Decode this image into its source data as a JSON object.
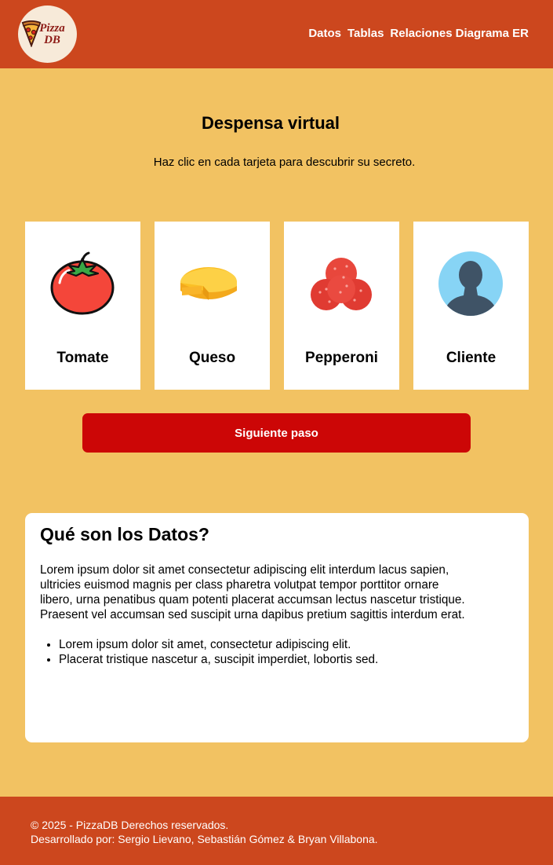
{
  "header": {
    "logo_text_line1": "Pizza",
    "logo_text_line2": "DB",
    "nav": [
      "Datos",
      "Tablas",
      "Relaciones",
      "Diagrama ER"
    ]
  },
  "main": {
    "title": "Despensa virtual",
    "subtitle": "Haz clic en cada tarjeta para descubrir su secreto.",
    "cards": [
      {
        "label": "Tomate",
        "icon": "tomato-icon"
      },
      {
        "label": "Queso",
        "icon": "cheese-icon"
      },
      {
        "label": "Pepperoni",
        "icon": "pepperoni-icon"
      },
      {
        "label": "Cliente",
        "icon": "user-avatar-icon"
      }
    ],
    "next_button": "Siguiente paso"
  },
  "info": {
    "title": "Qué son los Datos?",
    "body": "Lorem ipsum dolor sit amet consectetur adipiscing elit interdum lacus sapien, ultricies euismod magnis per class pharetra volutpat tempor porttitor ornare libero, urna penatibus quam potenti placerat accumsan lectus nascetur tristique. Praesent vel accumsan sed suscipit urna dapibus pretium sagittis interdum erat.",
    "bullets": [
      "Lorem ipsum dolor sit amet, consectetur adipiscing elit.",
      "Placerat tristique nascetur a, suscipit imperdiet, lobortis sed."
    ]
  },
  "footer": {
    "line1": "© 2025 - PizzaDB Derechos reservados.",
    "line2": "Desarrollado por: Sergio Lievano, Sebastián Gómez & Bryan Villabona."
  },
  "colors": {
    "header": "#cc471e",
    "background": "#f2c262",
    "button": "#cc0606"
  }
}
